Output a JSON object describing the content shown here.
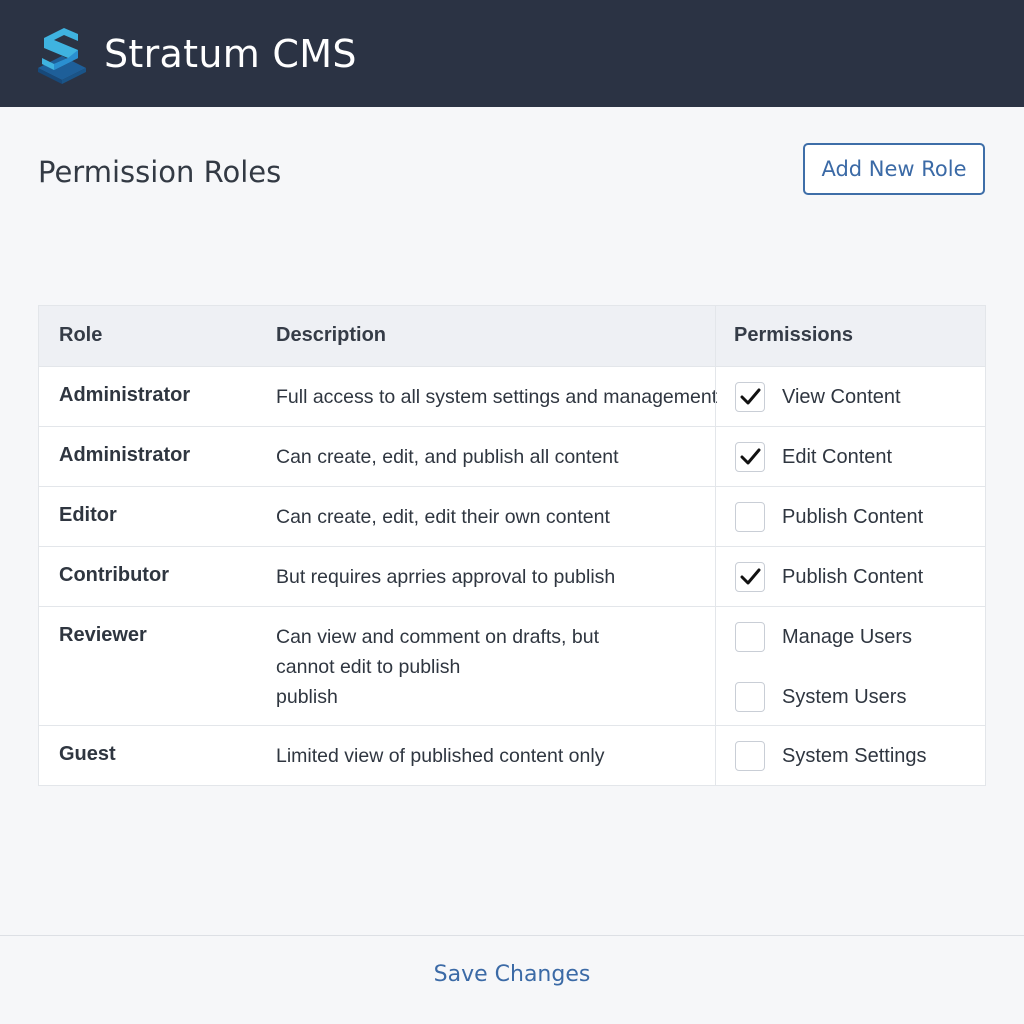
{
  "header": {
    "app_title": "Stratum CMS",
    "logo_icon": "stratum-logo-icon",
    "brand_color": "#2b3344",
    "logo_colors": [
      "#3fb3e0",
      "#2a7fc1",
      "#1e5f99"
    ]
  },
  "main": {
    "page_title": "Permission Roles",
    "add_role_label": "Add New Role",
    "accent_color": "#3b6aa6"
  },
  "table": {
    "headers": {
      "role": "Role",
      "description": "Description",
      "permissions": "Permissions"
    },
    "rows": [
      {
        "role": "Administrator",
        "description": [
          "Full access to all system settings and management"
        ],
        "permissions": [
          {
            "label": "View Content",
            "checked": true
          }
        ]
      },
      {
        "role": "Administrator",
        "description": [
          "Can create, edit, and publish all content"
        ],
        "permissions": [
          {
            "label": "Edit Content",
            "checked": true
          }
        ]
      },
      {
        "role": "Editor",
        "description": [
          "Can create, edit, edit their own content"
        ],
        "permissions": [
          {
            "label": "Publish Content",
            "checked": false
          }
        ]
      },
      {
        "role": "Contributor",
        "description": [
          "But requires aprries approval to publish"
        ],
        "permissions": [
          {
            "label": "Publish Content",
            "checked": true
          }
        ]
      },
      {
        "role": "Reviewer",
        "description": [
          "Can view and comment on drafts, but",
          "cannot edit to publish",
          "publish"
        ],
        "permissions": [
          {
            "label": "Manage Users",
            "checked": false
          },
          {
            "label": "System Users",
            "checked": false
          }
        ]
      },
      {
        "role": "Guest",
        "description": [
          "Limited view of published content only"
        ],
        "permissions": [
          {
            "label": "System Settings",
            "checked": false
          }
        ]
      }
    ]
  },
  "footer": {
    "save_label": "Save Changes"
  }
}
